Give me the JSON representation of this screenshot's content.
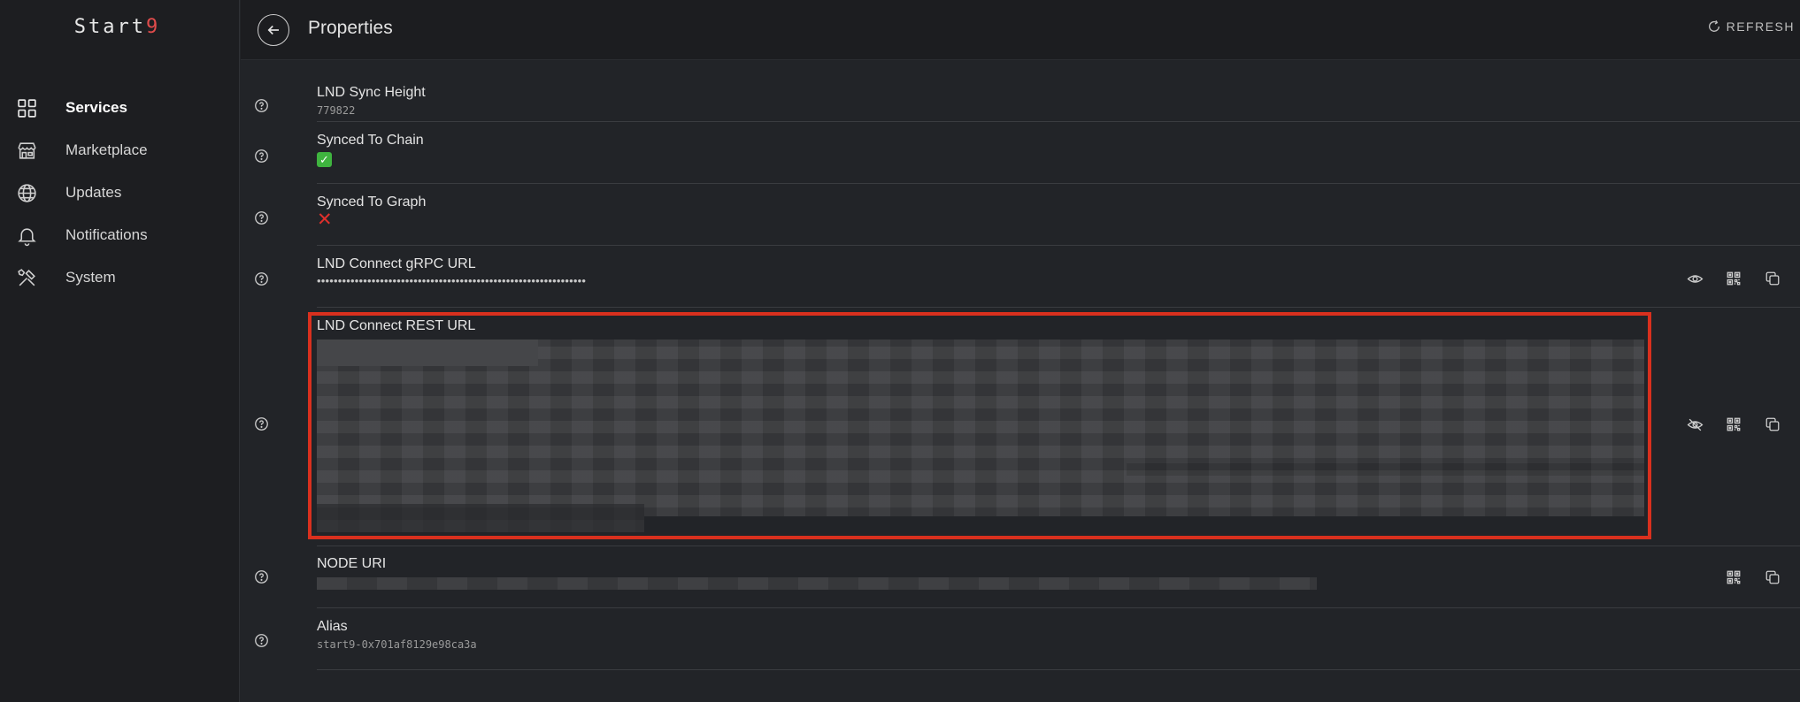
{
  "brand": {
    "text": "Start",
    "accent": "9"
  },
  "nav": [
    {
      "label": "Services",
      "icon": "grid-icon",
      "active": true
    },
    {
      "label": "Marketplace",
      "icon": "storefront-icon",
      "active": false
    },
    {
      "label": "Updates",
      "icon": "globe-icon",
      "active": false
    },
    {
      "label": "Notifications",
      "icon": "bell-icon",
      "active": false
    },
    {
      "label": "System",
      "icon": "tools-icon",
      "active": false
    }
  ],
  "header": {
    "title": "Properties",
    "refresh_label": "REFRESH"
  },
  "properties": [
    {
      "label": "LND Sync Height",
      "value": "779822"
    },
    {
      "label": "Synced To Chain",
      "value": "✅"
    },
    {
      "label": "Synced To Graph",
      "value": "❌"
    },
    {
      "label": "LND Connect gRPC URL",
      "value": "••••••••••••••••••••••••••••••••••••••••••••••••••••••••••••••••"
    },
    {
      "label": "LND Connect REST URL",
      "value": ""
    },
    {
      "label": "NODE URI",
      "value": ""
    },
    {
      "label": "Alias",
      "value": "start9-0x701af8129e98ca3a"
    }
  ],
  "colors": {
    "highlight": "#d9301e",
    "check": "#3fb43f",
    "cross": "#e0302c",
    "brand_accent": "#e04b4b"
  }
}
